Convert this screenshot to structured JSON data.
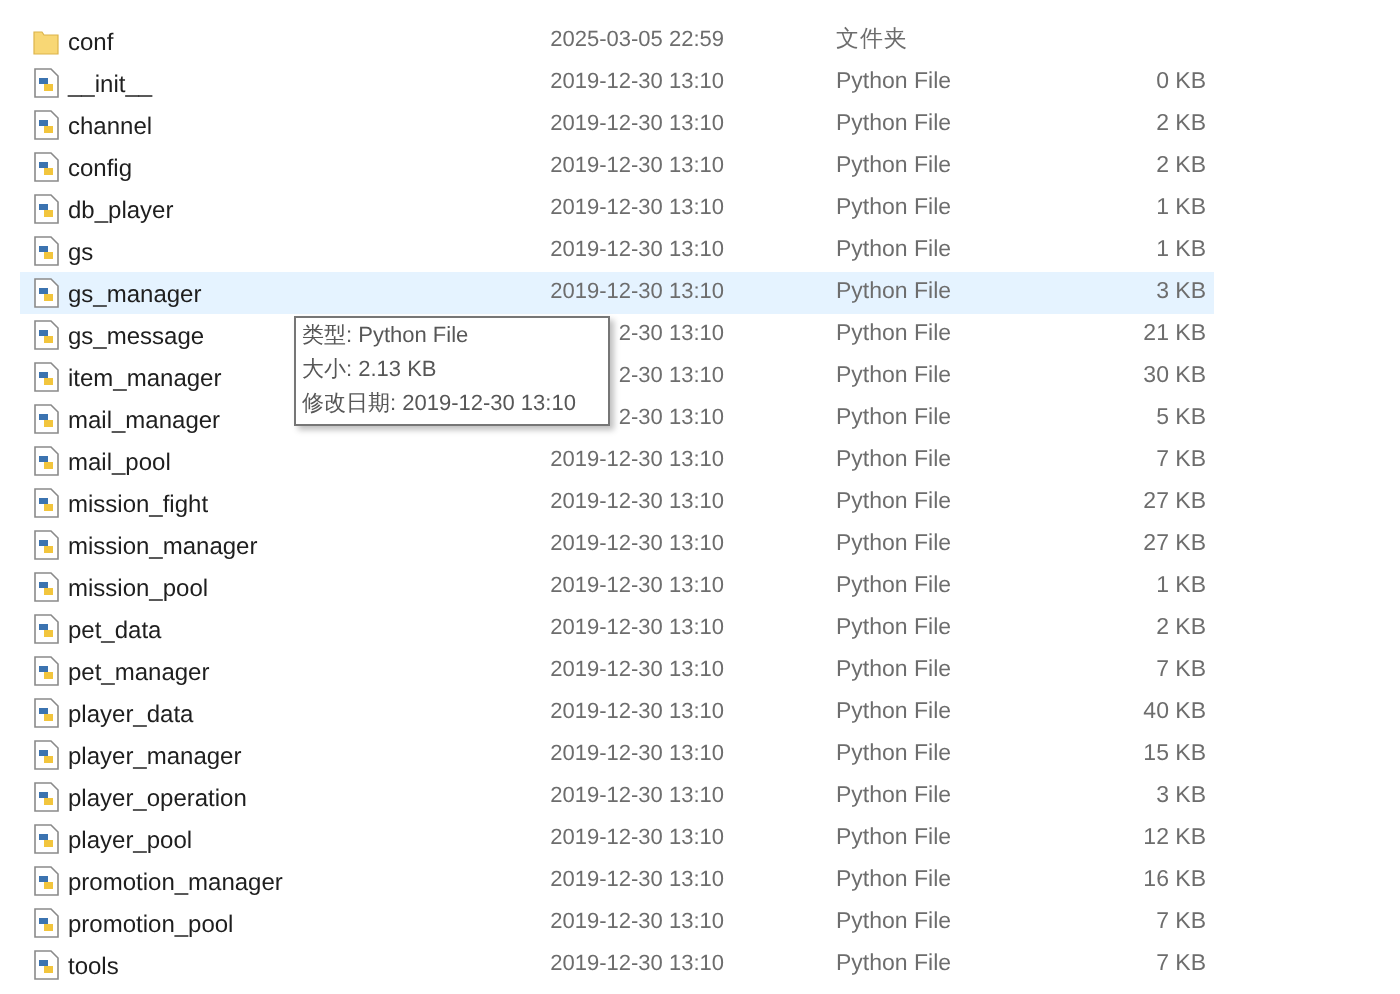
{
  "files": [
    {
      "name": "conf",
      "kind": "folder",
      "modified": "2025-03-05 22:59",
      "type": "文件夹",
      "selected": false
    },
    {
      "name": "__init__",
      "kind": "python",
      "modified": "2019-12-30 13:10",
      "type": "Python File",
      "size": "0 KB",
      "selected": false
    },
    {
      "name": "channel",
      "kind": "python",
      "modified": "2019-12-30 13:10",
      "type": "Python File",
      "size": "2 KB",
      "selected": false
    },
    {
      "name": "config",
      "kind": "python",
      "modified": "2019-12-30 13:10",
      "type": "Python File",
      "size": "2 KB",
      "selected": false
    },
    {
      "name": "db_player",
      "kind": "python",
      "modified": "2019-12-30 13:10",
      "type": "Python File",
      "size": "1 KB",
      "selected": false
    },
    {
      "name": "gs",
      "kind": "python",
      "modified": "2019-12-30 13:10",
      "type": "Python File",
      "size": "1 KB",
      "selected": false
    },
    {
      "name": "gs_manager",
      "kind": "python",
      "modified": "2019-12-30 13:10",
      "type": "Python File",
      "size": "3 KB",
      "selected": true
    },
    {
      "name": "gs_message",
      "kind": "python",
      "modified": "2-30 13:10",
      "type": "Python File",
      "size": "21 KB",
      "selected": false
    },
    {
      "name": "item_manager",
      "kind": "python",
      "modified": "2-30 13:10",
      "type": "Python File",
      "size": "30 KB",
      "selected": false
    },
    {
      "name": "mail_manager",
      "kind": "python",
      "modified": "2-30 13:10",
      "type": "Python File",
      "size": "5 KB",
      "selected": false
    },
    {
      "name": "mail_pool",
      "kind": "python",
      "modified": "2019-12-30 13:10",
      "type": "Python File",
      "size": "7 KB",
      "selected": false
    },
    {
      "name": "mission_fight",
      "kind": "python",
      "modified": "2019-12-30 13:10",
      "type": "Python File",
      "size": "27 KB",
      "selected": false
    },
    {
      "name": "mission_manager",
      "kind": "python",
      "modified": "2019-12-30 13:10",
      "type": "Python File",
      "size": "27 KB",
      "selected": false
    },
    {
      "name": "mission_pool",
      "kind": "python",
      "modified": "2019-12-30 13:10",
      "type": "Python File",
      "size": "1 KB",
      "selected": false
    },
    {
      "name": "pet_data",
      "kind": "python",
      "modified": "2019-12-30 13:10",
      "type": "Python File",
      "size": "2 KB",
      "selected": false
    },
    {
      "name": "pet_manager",
      "kind": "python",
      "modified": "2019-12-30 13:10",
      "type": "Python File",
      "size": "7 KB",
      "selected": false
    },
    {
      "name": "player_data",
      "kind": "python",
      "modified": "2019-12-30 13:10",
      "type": "Python File",
      "size": "40 KB",
      "selected": false
    },
    {
      "name": "player_manager",
      "kind": "python",
      "modified": "2019-12-30 13:10",
      "type": "Python File",
      "size": "15 KB",
      "selected": false
    },
    {
      "name": "player_operation",
      "kind": "python",
      "modified": "2019-12-30 13:10",
      "type": "Python File",
      "size": "3 KB",
      "selected": false
    },
    {
      "name": "player_pool",
      "kind": "python",
      "modified": "2019-12-30 13:10",
      "type": "Python File",
      "size": "12 KB",
      "selected": false
    },
    {
      "name": "promotion_manager",
      "kind": "python",
      "modified": "2019-12-30 13:10",
      "type": "Python File",
      "size": "16 KB",
      "selected": false
    },
    {
      "name": "promotion_pool",
      "kind": "python",
      "modified": "2019-12-30 13:10",
      "type": "Python File",
      "size": "7 KB",
      "selected": false
    },
    {
      "name": "tools",
      "kind": "python",
      "modified": "2019-12-30 13:10",
      "type": "Python File",
      "size": "7 KB",
      "selected": false
    }
  ],
  "tooltip": {
    "lines": [
      "类型: Python File",
      "大小: 2.13 KB",
      "修改日期: 2019-12-30 13:10"
    ]
  }
}
